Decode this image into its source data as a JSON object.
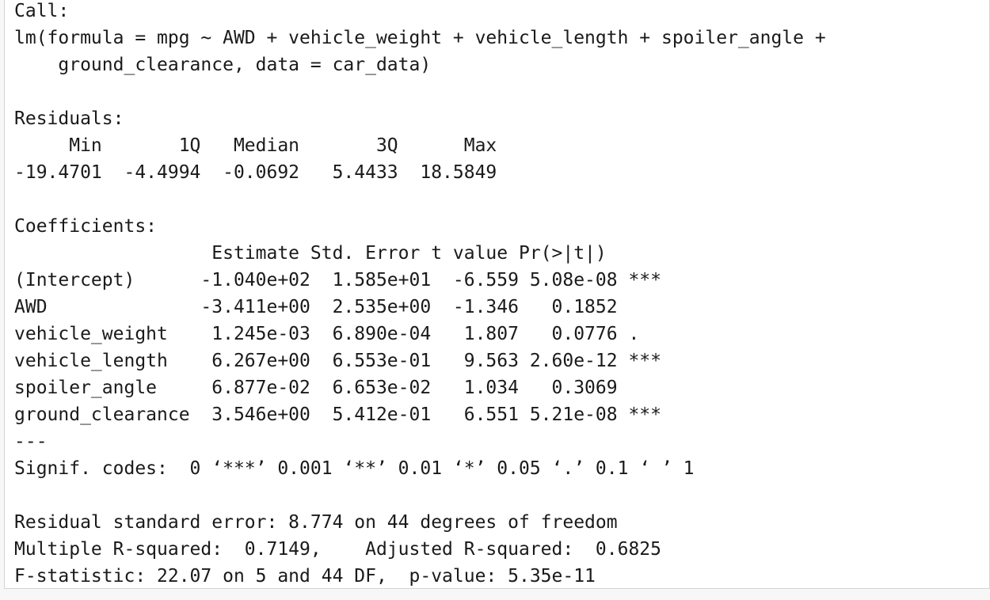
{
  "console_output": {
    "lines": [
      "Call:",
      "lm(formula = mpg ~ AWD + vehicle_weight + vehicle_length + spoiler_angle + ",
      "    ground_clearance, data = car_data)",
      "",
      "Residuals:",
      "     Min       1Q   Median       3Q      Max ",
      "-19.4701  -4.4994  -0.0692   5.4433  18.5849 ",
      "",
      "Coefficients:",
      "                  Estimate Std. Error t value Pr(>|t|)    ",
      "(Intercept)      -1.040e+02  1.585e+01  -6.559 5.08e-08 ***",
      "AWD              -3.411e+00  2.535e+00  -1.346   0.1852    ",
      "vehicle_weight    1.245e-03  6.890e-04   1.807   0.0776 .  ",
      "vehicle_length    6.267e+00  6.553e-01   9.563 2.60e-12 ***",
      "spoiler_angle     6.877e-02  6.653e-02   1.034   0.3069    ",
      "ground_clearance  3.546e+00  5.412e-01   6.551 5.21e-08 ***",
      "---",
      "Signif. codes:  0 ‘***’ 0.001 ‘**’ 0.01 ‘*’ 0.05 ‘.’ 0.1 ‘ ’ 1",
      "",
      "Residual standard error: 8.774 on 44 degrees of freedom",
      "Multiple R-squared:  0.7149,\tAdjusted R-squared:  0.6825 ",
      "F-statistic: 22.07 on 5 and 44 DF,  p-value: 5.35e-11"
    ]
  }
}
